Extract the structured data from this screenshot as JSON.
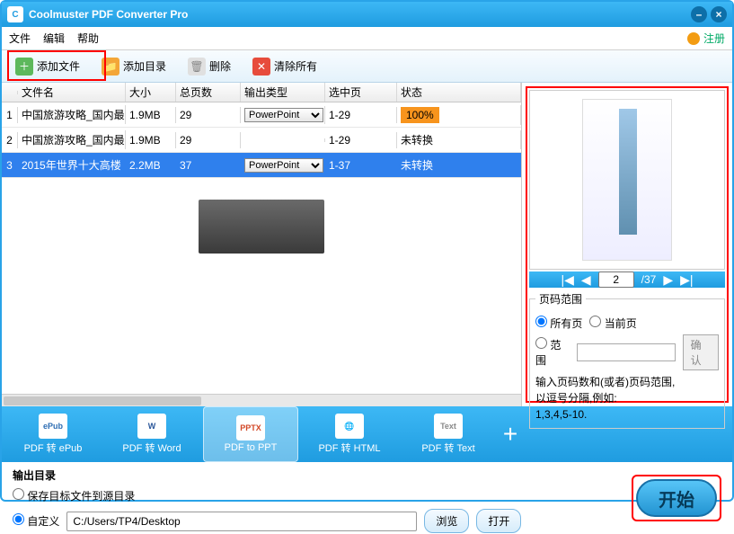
{
  "window": {
    "title": "Coolmuster PDF Converter Pro"
  },
  "menubar": {
    "file": "文件",
    "edit": "编辑",
    "help": "帮助",
    "register": "注册"
  },
  "toolbar": {
    "add_file": "添加文件",
    "add_dir": "添加目录",
    "delete": "删除",
    "clear_all": "清除所有"
  },
  "table": {
    "headers": {
      "name": "文件名",
      "size": "大小",
      "pages": "总页数",
      "type": "输出类型",
      "selected": "选中页",
      "status": "状态"
    },
    "rows": [
      {
        "idx": "1",
        "name": "中国旅游攻略_国内最",
        "size": "1.9MB",
        "pages": "29",
        "type": "PowerPoint",
        "selected": "1-29",
        "status": "100%",
        "status_kind": "done"
      },
      {
        "idx": "2",
        "name": "中国旅游攻略_国内最",
        "size": "1.9MB",
        "pages": "29",
        "type": "",
        "selected": "1-29",
        "status": "未转换",
        "status_kind": "pending"
      },
      {
        "idx": "3",
        "name": "2015年世界十大高楼",
        "size": "2.2MB",
        "pages": "37",
        "type": "PowerPoint",
        "selected": "1-37",
        "status": "未转换",
        "status_kind": "pending",
        "selected_row": true
      }
    ]
  },
  "formats": [
    {
      "label": "PDF 转 ePub",
      "icon": "ePub",
      "color": "#2d6db3"
    },
    {
      "label": "PDF 转 Word",
      "icon": "W",
      "color": "#2b579a"
    },
    {
      "label": "PDF to PPT",
      "icon": "PPTX",
      "color": "#d24726",
      "active": true
    },
    {
      "label": "PDF 转 HTML",
      "icon": "🌐",
      "color": "#3a9"
    },
    {
      "label": "PDF 转 Text",
      "icon": "Text",
      "color": "#888"
    }
  ],
  "pager": {
    "current": "2",
    "total": "/37"
  },
  "page_range": {
    "legend": "页码范围",
    "all": "所有页",
    "current": "当前页",
    "range": "范围",
    "range_value": "",
    "confirm": "确认",
    "hint1": "输入页码数和(或者)页码范围,",
    "hint2": "以逗号分隔,例如:",
    "hint3": "1,3,4,5-10."
  },
  "output": {
    "title": "输出目录",
    "save_source": "保存目标文件到源目录",
    "custom": "自定义",
    "path": "C:/Users/TP4/Desktop",
    "browse": "浏览",
    "open": "打开"
  },
  "start": "开始"
}
